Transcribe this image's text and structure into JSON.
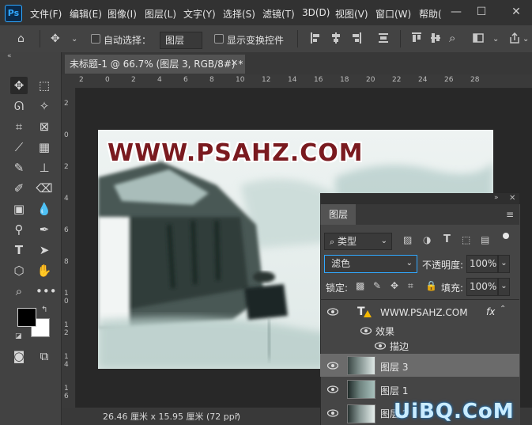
{
  "app": {
    "logo": "Ps",
    "menu": [
      "文件(F)",
      "编辑(E)",
      "图像(I)",
      "图层(L)",
      "文字(Y)",
      "选择(S)",
      "滤镜(T)",
      "3D(D)",
      "视图(V)",
      "窗口(W)",
      "帮助("
    ]
  },
  "options": {
    "auto_select_label": "自动选择：",
    "auto_select_target": "图层",
    "show_transform_label": "显示变换控件"
  },
  "document": {
    "tab_title": "未标题-1 @ 66.7% (图层 3, RGB/8#) *",
    "hruler_ticks": [
      "2",
      "0",
      "2",
      "4",
      "6",
      "8",
      "10",
      "12",
      "14",
      "16",
      "18",
      "20",
      "22",
      "24",
      "26",
      "28"
    ],
    "vruler_ticks": [
      "2",
      "0",
      "2",
      "4",
      "6",
      "8",
      "1 0",
      "1 2",
      "1 4",
      "1 6"
    ],
    "watermark_text": "WWW.PSAHZ.COM",
    "status": "26.46 厘米 x 15.95 厘米 (72 ppi)"
  },
  "layers_panel": {
    "tab": "图层",
    "filter_kind": "类型",
    "blend_mode": "滤色",
    "opacity_label": "不透明度:",
    "opacity_value": "100%",
    "lock_label": "锁定:",
    "fill_label": "填充:",
    "fill_value": "100%",
    "text_layer_name": "WWW.PSAHZ.COM",
    "fx": "fx",
    "effects_label": "效果",
    "stroke_label": "描边",
    "layers": [
      {
        "name": "图层 3"
      },
      {
        "name": "图层 1"
      },
      {
        "name": "图层 2"
      }
    ]
  },
  "site_watermark": "UiBQ.CoM",
  "colors": {
    "accent": "#31a8ff",
    "selected_layer": "#6b6b6b"
  }
}
